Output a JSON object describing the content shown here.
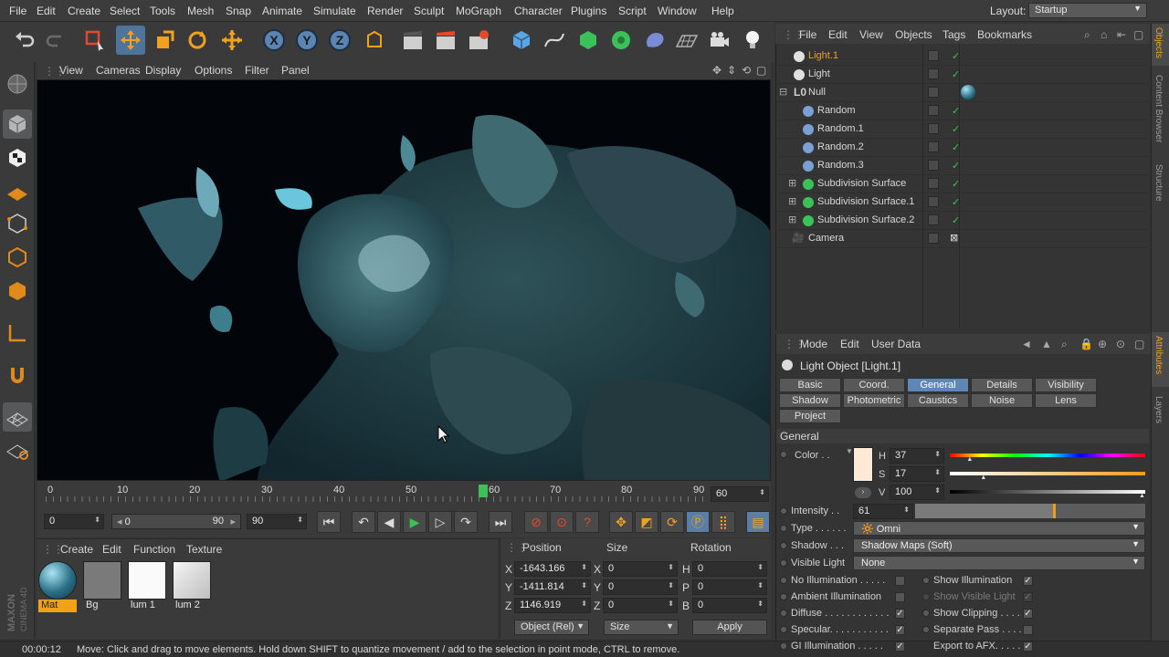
{
  "menubar": {
    "items": [
      "File",
      "Edit",
      "Create",
      "Select",
      "Tools",
      "Mesh",
      "Snap",
      "Animate",
      "Simulate",
      "Render",
      "Sculpt",
      "MoGraph",
      "Character",
      "Plugins",
      "Script",
      "Window",
      "Help"
    ],
    "layout_label": "Layout:",
    "layout_value": "Startup"
  },
  "viewport_menu": [
    "View",
    "Cameras",
    "Display",
    "Options",
    "Filter",
    "Panel"
  ],
  "timeline": {
    "ticks": [
      "0",
      "10",
      "20",
      "30",
      "40",
      "50",
      "60",
      "70",
      "80",
      "90"
    ],
    "current_frame_label": "60",
    "end_field": "60"
  },
  "transport": {
    "start_field": "0",
    "range_min": "0",
    "range_max": "90",
    "end_field": "90"
  },
  "material_manager": {
    "menu": [
      "Create",
      "Edit",
      "Function",
      "Texture"
    ],
    "materials": [
      {
        "name": "Mat",
        "selected": true
      },
      {
        "name": "Bg",
        "selected": false
      },
      {
        "name": "lum 1",
        "selected": false
      },
      {
        "name": "lum 2",
        "selected": false
      }
    ]
  },
  "coordinates": {
    "headers": {
      "position": "Position",
      "size": "Size",
      "rotation": "Rotation"
    },
    "rows": [
      {
        "axis": "X",
        "pos": "-1643.166",
        "size_axis": "X",
        "size": "0",
        "rot_axis": "H",
        "rot": "0"
      },
      {
        "axis": "Y",
        "pos": "-1411.814",
        "size_axis": "Y",
        "size": "0",
        "rot_axis": "P",
        "rot": "0"
      },
      {
        "axis": "Z",
        "pos": "1146.919",
        "size_axis": "Z",
        "size": "0",
        "rot_axis": "B",
        "rot": "0"
      }
    ],
    "mode_select": "Object (Rel)",
    "size_select": "Size",
    "apply_label": "Apply"
  },
  "status": {
    "time": "00:00:12",
    "message": "Move: Click and drag to move elements. Hold down SHIFT to quantize movement / add to the selection in point mode, CTRL to remove."
  },
  "object_manager": {
    "menu": [
      "File",
      "Edit",
      "View",
      "Objects",
      "Tags",
      "Bookmarks"
    ],
    "objects": [
      {
        "name": "Light.1",
        "type": "light",
        "selected": true
      },
      {
        "name": "Light",
        "type": "light",
        "selected": false
      },
      {
        "name": "Null",
        "type": "null",
        "selected": false
      },
      {
        "name": "Random",
        "type": "effector",
        "selected": false
      },
      {
        "name": "Random.1",
        "type": "effector",
        "selected": false
      },
      {
        "name": "Random.2",
        "type": "effector",
        "selected": false
      },
      {
        "name": "Random.3",
        "type": "effector",
        "selected": false
      },
      {
        "name": "Subdivision Surface",
        "type": "subdiv",
        "selected": false
      },
      {
        "name": "Subdivision Surface.1",
        "type": "subdiv",
        "selected": false
      },
      {
        "name": "Subdivision Surface.2",
        "type": "subdiv",
        "selected": false
      },
      {
        "name": "Camera",
        "type": "camera",
        "selected": false
      }
    ]
  },
  "attributes": {
    "menu": [
      "Mode",
      "Edit",
      "User Data"
    ],
    "object_title": "Light Object [Light.1]",
    "tabs": [
      "Basic",
      "Coord.",
      "General",
      "Details",
      "Visibility",
      "Shadow",
      "Photometric",
      "Caustics",
      "Noise",
      "Lens",
      "Project"
    ],
    "active_tab": "General",
    "section": "General",
    "color_label": "Color . .",
    "color_swatch": "#fde9d6",
    "h_label": "H",
    "h_value": "37",
    "s_label": "S",
    "s_value": "17",
    "v_label": "V",
    "v_value": "100",
    "h_level": 0.1,
    "s_level": 0.17,
    "v_level": 1.0,
    "intensity_label": "Intensity . .",
    "intensity_value": "61",
    "intensity_level": 0.61,
    "type_label": "Type . . . . . .",
    "type_value": "Omni",
    "shadow_label": "Shadow . . .",
    "shadow_value": "Shadow Maps (Soft)",
    "visible_light_label": "Visible Light",
    "visible_light_value": "None",
    "checks_left": [
      {
        "label": "No Illumination . . . . .",
        "checked": false
      },
      {
        "label": "Ambient Illumination",
        "checked": false
      },
      {
        "label": "Diffuse . . . . . . . . . . . .",
        "checked": true
      },
      {
        "label": "Specular. . . . . . . . . . .",
        "checked": true
      },
      {
        "label": "GI Illumination . . . . .",
        "checked": true
      }
    ],
    "checks_right": [
      {
        "label": "Show Illumination",
        "checked": true
      },
      {
        "label": "Show Visible Light",
        "checked": true
      },
      {
        "label": "Show Clipping . . . .",
        "checked": true
      },
      {
        "label": "Separate Pass . . . .",
        "checked": false
      },
      {
        "label": "Export to AFX. . . . .",
        "checked": true
      }
    ]
  },
  "right_tabs": [
    "Objects",
    "Content Browser",
    "Structure",
    "Attributes",
    "Layers"
  ],
  "brand": [
    "MAXON",
    "CINEMA 4D"
  ]
}
